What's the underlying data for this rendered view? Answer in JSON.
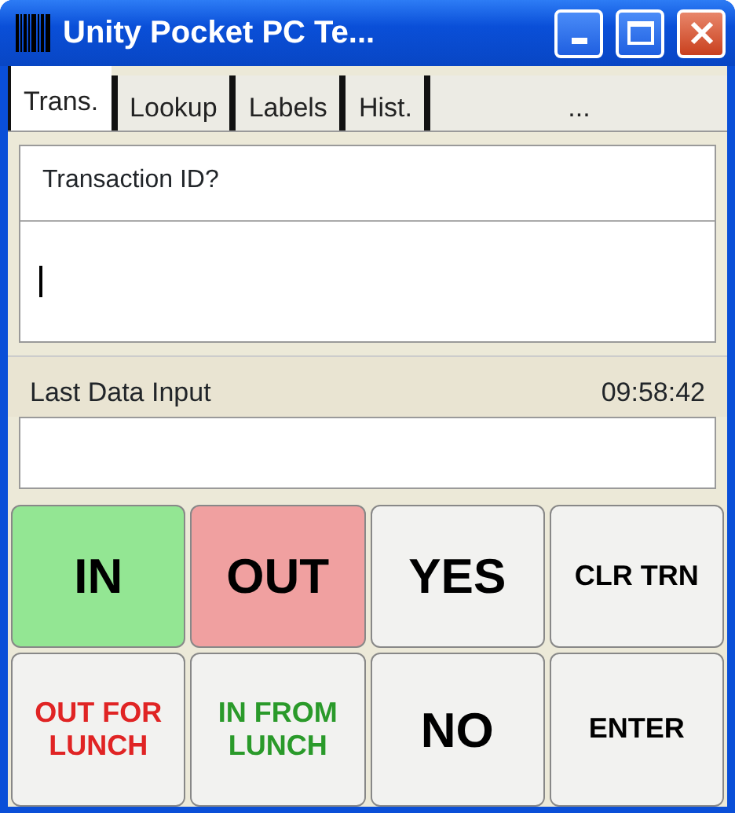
{
  "window": {
    "title": "Unity Pocket PC Te..."
  },
  "tabs": [
    {
      "label": "Trans.",
      "selected": true
    },
    {
      "label": "Lookup",
      "selected": false
    },
    {
      "label": "Labels",
      "selected": false
    },
    {
      "label": "Hist.",
      "selected": false
    },
    {
      "label": "...",
      "selected": false
    }
  ],
  "prompt": {
    "text": "Transaction ID?"
  },
  "last_data": {
    "label": "Last Data Input",
    "time": "09:58:42"
  },
  "buttons": [
    {
      "label": "IN",
      "kind": "big",
      "color": "#93e693"
    },
    {
      "label": "OUT",
      "kind": "big",
      "color": "#f0a0a0"
    },
    {
      "label": "YES",
      "kind": "big",
      "color": "#f2f2f0"
    },
    {
      "label": "CLR TRN",
      "kind": "small",
      "color": "#f2f2f0"
    },
    {
      "label": "OUT FOR LUNCH",
      "kind": "warn",
      "color": "#f2f2f0"
    },
    {
      "label": "IN FROM LUNCH",
      "kind": "go",
      "color": "#f2f2f0"
    },
    {
      "label": "NO",
      "kind": "big",
      "color": "#f2f2f0"
    },
    {
      "label": "ENTER",
      "kind": "small",
      "color": "#f2f2f0"
    }
  ]
}
